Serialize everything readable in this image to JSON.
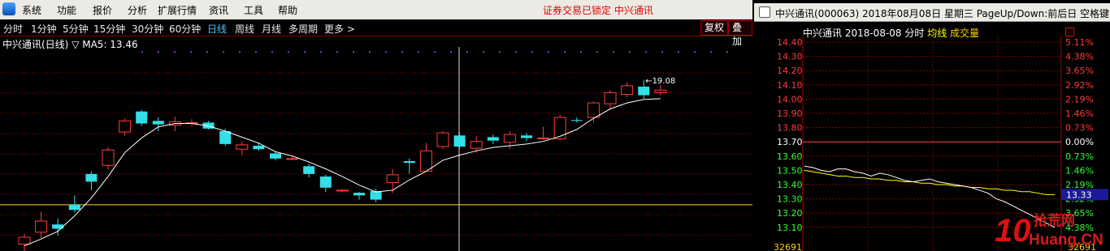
{
  "menubar": {
    "items": [
      "系统",
      "功能",
      "报价",
      "分析",
      "扩展行情",
      "资讯",
      "工具",
      "帮助"
    ],
    "notice": "证券交易已锁定 中兴通讯",
    "buttons": [
      "_",
      "□",
      "×"
    ]
  },
  "periodbar": {
    "periods": [
      "分时",
      "1分钟",
      "5分钟",
      "15分钟",
      "30分钟",
      "60分钟",
      "日线",
      "周线",
      "月线",
      "多周期",
      "更多 >"
    ],
    "active": "日线",
    "buttons": [
      "复权",
      "叠加"
    ]
  },
  "kline": {
    "title": "中兴通讯(日线)",
    "ma_label": "▽ MA5: 13.46",
    "max_label": "19.08",
    "colors": {
      "up": "#ff3b3b",
      "down": "#33e0e8",
      "ma": "#ffffff",
      "grid": "#7a0000"
    },
    "candles": [
      {
        "o": 12.48,
        "c": 12.56,
        "h": 12.6,
        "l": 12.4
      },
      {
        "o": 12.62,
        "c": 12.75,
        "h": 12.86,
        "l": 12.55
      },
      {
        "o": 12.71,
        "c": 12.66,
        "h": 12.78,
        "l": 12.58
      },
      {
        "o": 12.94,
        "c": 12.88,
        "h": 13.05,
        "l": 12.85
      },
      {
        "o": 13.3,
        "c": 13.21,
        "h": 13.33,
        "l": 13.11
      },
      {
        "o": 13.4,
        "c": 13.58,
        "h": 13.61,
        "l": 13.35
      },
      {
        "o": 13.79,
        "c": 13.92,
        "h": 13.95,
        "l": 13.75
      },
      {
        "o": 14.03,
        "c": 13.89,
        "h": 14.05,
        "l": 13.86
      },
      {
        "o": 13.92,
        "c": 13.88,
        "h": 13.96,
        "l": 13.8
      },
      {
        "o": 13.87,
        "c": 13.91,
        "h": 13.97,
        "l": 13.8
      },
      {
        "o": 13.9,
        "c": 13.9,
        "h": 13.94,
        "l": 13.86
      },
      {
        "o": 13.9,
        "c": 13.83,
        "h": 13.92,
        "l": 13.82
      },
      {
        "o": 13.8,
        "c": 13.65,
        "h": 13.83,
        "l": 13.63
      },
      {
        "o": 13.59,
        "c": 13.64,
        "h": 13.68,
        "l": 13.52
      },
      {
        "o": 13.63,
        "c": 13.59,
        "h": 13.67,
        "l": 13.57
      },
      {
        "o": 13.54,
        "c": 13.48,
        "h": 13.56,
        "l": 13.46
      },
      {
        "o": 13.48,
        "c": 13.48,
        "h": 13.51,
        "l": 13.46
      },
      {
        "o": 13.39,
        "c": 13.3,
        "h": 13.42,
        "l": 13.26
      },
      {
        "o": 13.27,
        "c": 13.14,
        "h": 13.29,
        "l": 13.09
      },
      {
        "o": 13.11,
        "c": 13.11,
        "h": 13.12,
        "l": 13.09
      },
      {
        "o": 13.08,
        "c": 13.05,
        "h": 13.09,
        "l": 13.0
      },
      {
        "o": 13.1,
        "c": 13.0,
        "h": 13.13,
        "l": 12.97
      },
      {
        "o": 13.2,
        "c": 13.29,
        "h": 13.36,
        "l": 13.08
      },
      {
        "o": 13.45,
        "c": 13.43,
        "h": 13.48,
        "l": 13.3
      },
      {
        "o": 13.33,
        "c": 13.57,
        "h": 13.66,
        "l": 13.33
      },
      {
        "o": 13.62,
        "c": 13.78,
        "h": 13.8,
        "l": 13.59
      },
      {
        "o": 13.75,
        "c": 13.62,
        "h": 13.79,
        "l": 13.6
      },
      {
        "o": 13.6,
        "c": 13.68,
        "h": 13.74,
        "l": 13.55
      },
      {
        "o": 13.73,
        "c": 13.69,
        "h": 13.76,
        "l": 13.65
      },
      {
        "o": 13.67,
        "c": 13.76,
        "h": 13.8,
        "l": 13.59
      },
      {
        "o": 13.75,
        "c": 13.72,
        "h": 13.78,
        "l": 13.68
      },
      {
        "o": 13.72,
        "c": 13.72,
        "h": 13.85,
        "l": 13.7
      },
      {
        "o": 13.71,
        "c": 13.96,
        "h": 13.99,
        "l": 13.69
      },
      {
        "o": 13.93,
        "c": 13.92,
        "h": 13.96,
        "l": 13.9
      },
      {
        "o": 13.96,
        "c": 14.13,
        "h": 14.15,
        "l": 13.9
      },
      {
        "o": 14.12,
        "c": 14.25,
        "h": 14.28,
        "l": 14.05
      },
      {
        "o": 14.23,
        "c": 14.33,
        "h": 14.37,
        "l": 14.2
      },
      {
        "o": 14.32,
        "c": 14.22,
        "h": 14.4,
        "l": 14.18
      },
      {
        "o": 14.25,
        "c": 14.28,
        "h": 14.34,
        "l": 14.22
      }
    ],
    "ma5": [
      12.46,
      12.54,
      12.63,
      12.81,
      13.02,
      13.27,
      13.55,
      13.72,
      13.85,
      13.89,
      13.89,
      13.86,
      13.8,
      13.73,
      13.66,
      13.56,
      13.51,
      13.44,
      13.36,
      13.27,
      13.17,
      13.09,
      13.11,
      13.23,
      13.33,
      13.46,
      13.52,
      13.57,
      13.61,
      13.63,
      13.65,
      13.68,
      13.74,
      13.82,
      13.95,
      14.06,
      14.13,
      14.17,
      14.18
    ],
    "horizontal_line_price": 12.94
  },
  "popup": {
    "title": "中兴通讯(000063) 2018年08月08日 星期三 PageUp/Down:前后日 空格键:操作",
    "sub_name": "中兴通讯  2018-08-08 分时",
    "sub_avg": "均线",
    "sub_vol": "成交量",
    "price_labels": [
      "14.40",
      "14.30",
      "14.20",
      "14.10",
      "14.00",
      "13.90",
      "13.80",
      "13.70",
      "13.60",
      "13.50",
      "13.40",
      "13.30",
      "13.20",
      "13.10"
    ],
    "pct_labels": [
      "5.11%",
      "4.38%",
      "3.65%",
      "2.92%",
      "2.19%",
      "1.46%",
      "0.73%",
      "0.00%",
      "0.73%",
      "1.46%",
      "2.19%",
      "2.92%",
      "3.65%",
      "4.38%"
    ],
    "current_price": "13.33",
    "volume_label": "32691",
    "colors": {
      "up": "#ff3b3b",
      "flat": "#ffffff",
      "down": "#33ff33",
      "price_line": "#ffffff",
      "avg_line": "#ffff00"
    },
    "price_line": [
      13.53,
      13.52,
      13.5,
      13.49,
      13.51,
      13.51,
      13.49,
      13.48,
      13.46,
      13.48,
      13.47,
      13.45,
      13.43,
      13.42,
      13.43,
      13.44,
      13.42,
      13.41,
      13.4,
      13.39,
      13.38,
      13.36,
      13.34,
      13.3,
      13.28,
      13.25,
      13.22,
      13.19,
      13.16,
      13.13,
      13.1
    ],
    "avg_line": [
      13.5,
      13.49,
      13.48,
      13.47,
      13.46,
      13.46,
      13.45,
      13.45,
      13.44,
      13.44,
      13.43,
      13.43,
      13.42,
      13.42,
      13.41,
      13.41,
      13.4,
      13.4,
      13.39,
      13.39,
      13.38,
      13.38,
      13.37,
      13.37,
      13.36,
      13.36,
      13.35,
      13.35,
      13.34,
      13.33,
      13.33
    ]
  },
  "watermark": {
    "line1": "10",
    "line2": "拾荒网",
    "line3": "Huang.CN"
  }
}
